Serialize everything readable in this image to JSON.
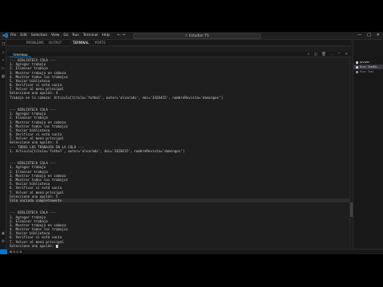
{
  "window": {
    "menu": [
      "File",
      "Edit",
      "Selection",
      "View",
      "Go",
      "Run",
      "Terminal",
      "Help"
    ],
    "search_label": "Estudiar TS",
    "minimize": "—",
    "maximize": "□",
    "close": "✕"
  },
  "editor": {
    "tabs": [
      {
        "label": "TERMINAL",
        "active": true
      },
      {
        "label": "PROBLEMS",
        "active": false
      },
      {
        "label": "OUTPUT",
        "active": false
      },
      {
        "label": "DEBUG CONSOLE",
        "active": false
      },
      {
        "label": "PORTS",
        "active": false
      }
    ],
    "breadcrumb": ""
  },
  "terminal_panel": {
    "tabs": [
      {
        "label": "TERMINAL",
        "active": true
      },
      {
        "label": "PROBLEMS",
        "active": false
      },
      {
        "label": "PORTS",
        "active": false
      }
    ]
  },
  "terminal": {
    "lines": [
      "--- BIBLIOTECA COLA ---",
      "1. Agregar trabajo",
      "2. Eliminar trabajo",
      "3. Mostrar trabajo en cabeza",
      "4. Mostrar todos los trabajos",
      "5. Vaciar biblioteca",
      "6. Verificar si está vacía",
      "7. Volver al menú principal",
      "Seleccione una opción: 4",
      "Trabajo en la cabeza: Articulo[titulo='futbol', autor='alvarado', doi='3426415', nombreRevista='domingos']",
      "",
      "",
      "--- BIBLIOTECA COLA ---",
      "1. Agregar trabajo",
      "2. Eliminar trabajo",
      "3. Mostrar trabajo en cabeza",
      "4. Mostrar todos los trabajos",
      "5. Vaciar biblioteca",
      "6. Verificar si está vacía",
      "7. Volver al menú principal",
      "Seleccione una opción: 4",
      "--- TODOS LOS TRABAJOS EN LA COLA ---",
      "1. Articulo[titulo='futbol', autor='alvarado', doi='3426415', nombreRevista='domingos']",
      "",
      "",
      "--- BIBLIOTECA COLA ---",
      "1. Agregar trabajo",
      "2. Eliminar trabajo",
      "3. Mostrar trabajo en cabeza",
      "4. Mostrar todos los trabajos",
      "5. Vaciar biblioteca",
      "6. Verificar si está vacía",
      "7. Volver al menú principal",
      "Seleccione una opción: 5",
      "Cola vaciada completamente",
      "",
      "",
      "--- BIBLIOTECA COLA ---",
      "1. Agregar trabajo",
      "2. Eliminar trabajo",
      "3. Mostrar trabajo en cabeza",
      "4. Mostrar todos los trabajos",
      "5. Vaciar biblioteca",
      "6. Verificar si está vacía",
      "7. Volver al menú principal",
      "Seleccione una opción: "
    ],
    "highlight_line": 34
  },
  "right_panel": {
    "header": [
      "TERMINAL",
      "JAVA"
    ],
    "items": [
      {
        "label": "javadc",
        "selected": false
      },
      {
        "label": "Run: TestBi...",
        "selected": true
      },
      {
        "label": "Run: Test",
        "selected": false
      }
    ]
  },
  "statusbar": {
    "remote": "><",
    "left": [
      "⊗ 0 ⚠ 0",
      "Java: Ready"
    ],
    "right": [
      "Ln 1, Col 1",
      "Spaces: 4",
      "UTF-8",
      "CRLF",
      "Java"
    ]
  },
  "colors": {
    "accent": "#0078d4",
    "background": "#1e1e1e",
    "text": "#cccccc"
  }
}
